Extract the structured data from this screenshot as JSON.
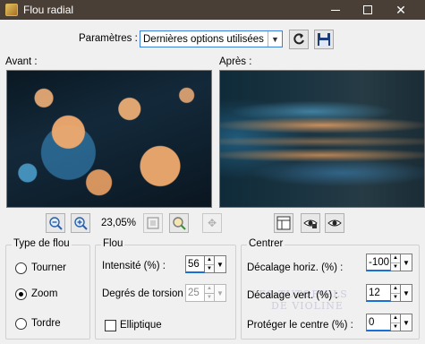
{
  "window": {
    "title": "Flou radial"
  },
  "params": {
    "label": "Paramètres :",
    "selected": "Dernières options utilisées"
  },
  "preview": {
    "before_label": "Avant :",
    "after_label": "Après :"
  },
  "zoom": {
    "value": "23,05%"
  },
  "blur_type": {
    "title": "Type de flou",
    "options": [
      "Tourner",
      "Zoom",
      "Tordre"
    ],
    "selected": "Zoom"
  },
  "flou": {
    "title": "Flou",
    "intensity_label": "Intensité (%) :",
    "intensity_value": "56",
    "torsion_label": "Degrés de torsion :",
    "torsion_value": "25",
    "elliptic_label": "Elliptique",
    "elliptic_checked": false
  },
  "centre": {
    "title": "Centrer",
    "horiz_label": "Décalage horiz. (%) :",
    "horiz_value": "-100",
    "vert_label": "Décalage vert. (%) :",
    "vert_value": "12",
    "protect_label": "Protéger le centre (%) :",
    "protect_value": "0"
  },
  "watermark": {
    "line1": "LES TUTORIELS",
    "line2": "DE VIOLINE"
  },
  "colors": {
    "titlebar": "#4a3f36",
    "accent": "#1a6fd8",
    "dialog": "#f0f0f0"
  }
}
